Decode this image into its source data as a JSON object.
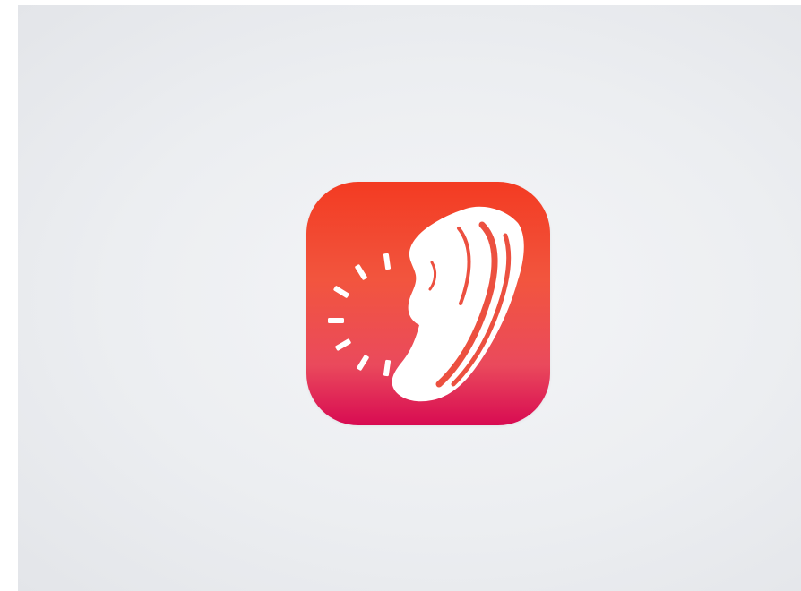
{
  "app_icon": {
    "icon": "running-shoe-stopwatch-icon",
    "colors": {
      "gradient_top": "#f33b22",
      "gradient_mid": "#f2553e",
      "gradient_lower": "#ea4a5c",
      "gradient_bottom": "#d80b52",
      "glyph": "#ffffff"
    }
  }
}
